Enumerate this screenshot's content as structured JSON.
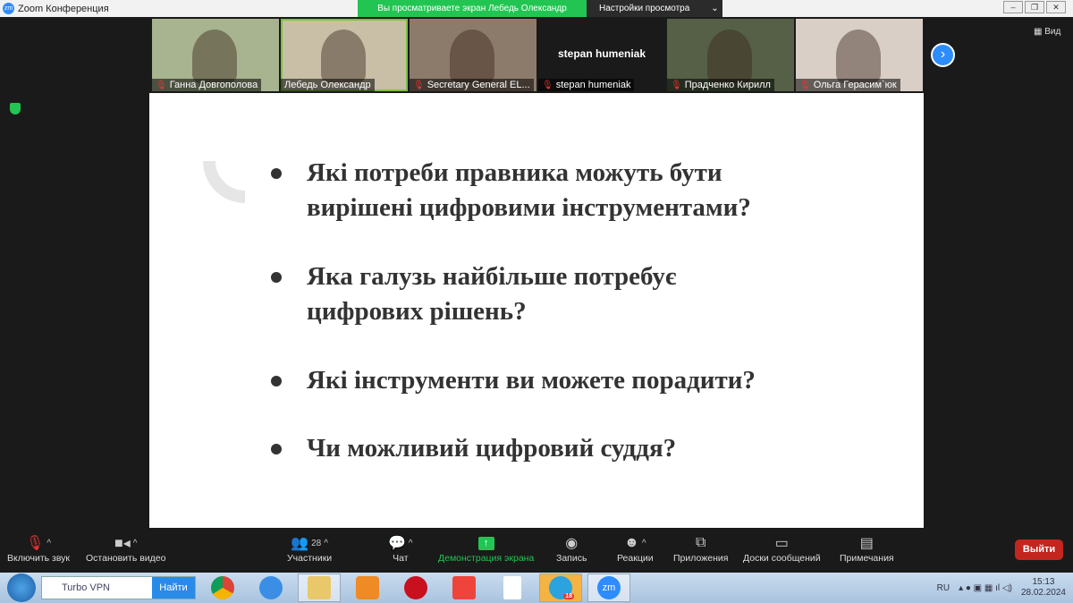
{
  "window": {
    "title": "Zoom Конференция",
    "logo": "zm",
    "viewing_banner": "Вы просматриваете экран Лебедь Олександр",
    "view_settings": "Настройки просмотра",
    "view_label": "Вид"
  },
  "participants": [
    {
      "name": "Ганна Довгополова",
      "muted": true,
      "bg": "#a7b48f"
    },
    {
      "name": "Лебедь Олександр",
      "muted": false,
      "bg": "#c9bfa6",
      "active": true
    },
    {
      "name": "Secretary General EL...",
      "muted": true,
      "bg": "#8c7b6b"
    },
    {
      "name": "stepan humeniak",
      "muted": true,
      "bg": "#1a1a1a",
      "label": "stepan humeniak"
    },
    {
      "name": "Прадченко Кирилл",
      "muted": true,
      "bg": "#556046"
    },
    {
      "name": "Ольга Герасим`юк",
      "muted": true,
      "bg": "#d9cfc6"
    }
  ],
  "slide": {
    "bullets": [
      [
        "Які потреби правника можуть бути",
        "вирішені цифровими інструментами?"
      ],
      [
        "Яка галузь найбільше потребує",
        "цифрових рішень?"
      ],
      [
        "Які інструменти ви можете порадити?"
      ],
      [
        "Чи можливий цифровий суддя?"
      ]
    ]
  },
  "toolbar": {
    "unmute": "Включить звук",
    "stop_video": "Остановить видео",
    "participants": "Участники",
    "participants_count": "28",
    "chat": "Чат",
    "share": "Демонстрация экрана",
    "record": "Запись",
    "reactions": "Реакции",
    "apps": "Приложения",
    "whiteboards": "Доски сообщений",
    "notes": "Примечания",
    "leave": "Выйти"
  },
  "taskbar": {
    "search_value": "Turbo VPN",
    "search_button": "Найти",
    "lang": "RU",
    "time": "15:13",
    "date": "28.02.2024",
    "telegram_badge": "18",
    "zoom_label": "zm"
  }
}
